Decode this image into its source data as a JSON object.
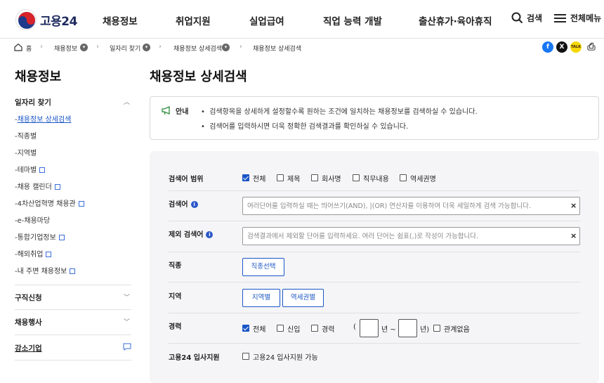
{
  "header": {
    "logo_text": "고용24",
    "nav": [
      "채용정보",
      "취업지원",
      "실업급여",
      "직업 능력 개발",
      "출산휴가·육아휴직"
    ],
    "search_label": "검색",
    "menu_label": "전체메뉴"
  },
  "breadcrumb": {
    "home": "홈",
    "items": [
      "채용정보",
      "일자리 찾기",
      "채용정보 상세검색",
      "채용정보 상세검색"
    ]
  },
  "share": {
    "facebook": "f",
    "x": "X",
    "kakao": "TALK",
    "print": "⎙"
  },
  "sidebar": {
    "title": "채용정보",
    "section1": "일자리 찾기",
    "items": [
      {
        "label": "채용정보 상세검색"
      },
      {
        "label": "직종별"
      },
      {
        "label": "지역별"
      },
      {
        "label": "테마별"
      },
      {
        "label": "채용 캘린더"
      },
      {
        "label": "4차산업혁명 채용관"
      },
      {
        "label": "e-채용마당"
      },
      {
        "label": "통합기업정보"
      },
      {
        "label": "해외취업"
      },
      {
        "label": "내 주변 채용정보"
      }
    ],
    "section2": "구직신청",
    "section3": "채용행사",
    "section4": "강소기업"
  },
  "main": {
    "title": "채용정보 상세검색",
    "notice": {
      "label": "안내",
      "lines": [
        "검색항목을 상세하게 설정할수록 원하는 조건에 일치하는 채용정보를 검색하실 수 있습니다.",
        "검색어를 입력하시면 더욱 정확한 검색결과를 확인하실 수 있습니다."
      ]
    },
    "form": {
      "scope_label": "검색어 범위",
      "scope_options": [
        "전체",
        "제목",
        "회사명",
        "직무내용",
        "역세권명"
      ],
      "keyword_label": "검색어",
      "keyword_placeholder": "여러단어를 입력하실 때는 띄어쓰기(AND), |(OR) 연산자를 이용하여 더욱 세밀하게 검색 가능합니다.",
      "exclude_label": "제외 검색어",
      "exclude_placeholder": "검색결과에서 제외할 단어를 입력하세요. 여러 단어는 쉼표(,)로 작성이 가능합니다.",
      "job_label": "직종",
      "job_button": "직종선택",
      "region_label": "지역",
      "region_buttons": [
        "지역별",
        "역세권별"
      ],
      "career_label": "경력",
      "career_options": [
        "전체",
        "신입",
        "경력"
      ],
      "career_paren_open": "(",
      "career_year_sep": "년 ~",
      "career_year_end": "년)",
      "career_irrelevant": "관계없음",
      "support_label": "고용24 입사지원",
      "support_option": "고용24 입사지원 가능"
    }
  }
}
